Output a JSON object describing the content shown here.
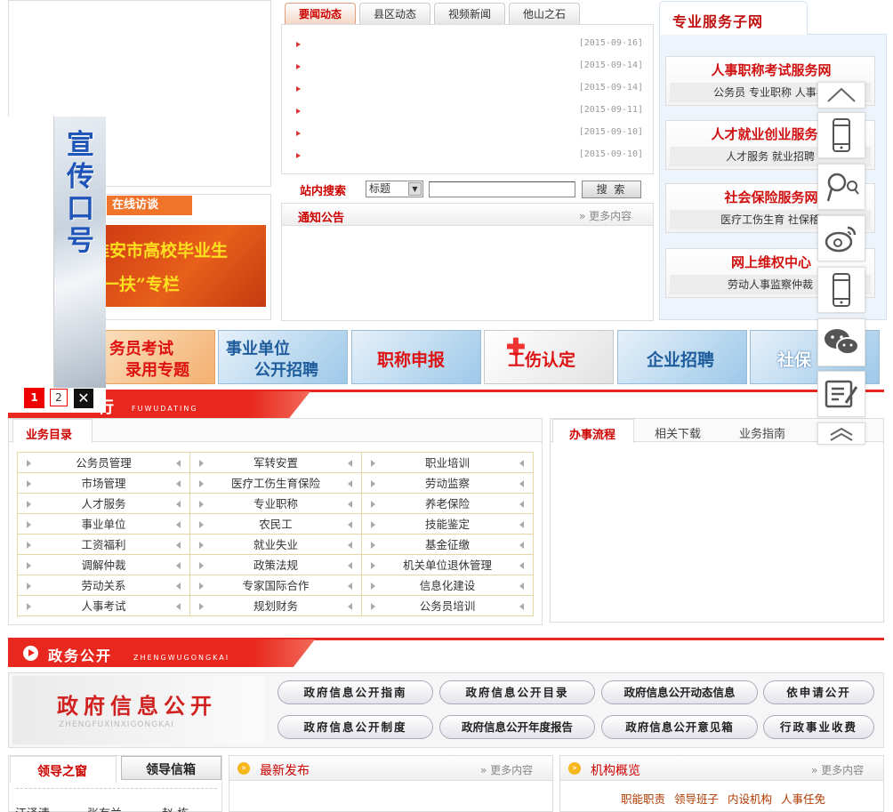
{
  "news": {
    "tabs": [
      "要闻动态",
      "县区动态",
      "视频新闻",
      "他山之石"
    ],
    "dates": [
      "[2015-09-16]",
      "[2015-09-14]",
      "[2015-09-14]",
      "[2015-09-11]",
      "[2015-09-10]",
      "[2015-09-10]"
    ]
  },
  "search": {
    "label": "站内搜索",
    "select_value": "标题",
    "button": "搜 索"
  },
  "notice": {
    "title": "通知公告",
    "more": "更多内容"
  },
  "interview": {
    "label": "在线访谈",
    "banner_line1": "淮安市高校毕业生",
    "banner_line2": "“一扶”专栏"
  },
  "slogan": {
    "text": "宣传口号",
    "pages": [
      "1",
      "2"
    ]
  },
  "services": {
    "header": "专业服务子网",
    "items": [
      {
        "title": "人事职称考试服务网",
        "sub": "公务员 专业职称 人事考"
      },
      {
        "title": "人才就业创业服务网",
        "sub": "人才服务 就业招聘"
      },
      {
        "title": "社会保险服务网",
        "sub": "医疗工伤生育 社保稽"
      },
      {
        "title": "网上维权中心",
        "sub": "劳动人事监察仲裁"
      }
    ]
  },
  "banners": [
    "务员考试",
    "录用专题",
    "事业单位",
    "公开招聘",
    "职称申报",
    "工伤认定",
    "企业招聘",
    "社保"
  ],
  "service_hall": {
    "title": "行",
    "pinyin": "FUWUDATING"
  },
  "business": {
    "tab": "业务目录",
    "rows": [
      [
        "公务员管理",
        "军转安置",
        "职业培训"
      ],
      [
        "市场管理",
        "医疗工伤生育保险",
        "劳动监察"
      ],
      [
        "人才服务",
        "专业职称",
        "养老保险"
      ],
      [
        "事业单位",
        "农民工",
        "技能鉴定"
      ],
      [
        "工资福利",
        "就业失业",
        "基金征缴"
      ],
      [
        "调解仲裁",
        "政策法规",
        "机关单位退休管理"
      ],
      [
        "劳动关系",
        "专家国际合作",
        "信息化建设"
      ],
      [
        "人事考试",
        "规划财务",
        "公务员培训"
      ]
    ]
  },
  "process": {
    "tabs": [
      "办事流程",
      "相关下载",
      "业务指南"
    ]
  },
  "gov": {
    "title": "政务公开",
    "pinyin": "ZHENGWUGONGKAI",
    "banner_title": "政府信息公开",
    "banner_pinyin": "ZHENGFUXINXIGONGKAI",
    "buttons": [
      [
        "政府信息公开指南",
        "政府信息公开目录",
        "政府信息公开动态信息",
        "依申请公开"
      ],
      [
        "政府信息公开制度",
        "政府信息公开年度报告",
        "政府信息公开意见箱",
        "行政事业收费"
      ]
    ]
  },
  "bottom": {
    "leader_tabs": [
      "领导之窗",
      "领导信箱"
    ],
    "leader_names": [
      "江泽清",
      "张有兰",
      "赵 栋"
    ],
    "latest": {
      "title": "最新发布",
      "more": "更多内容"
    },
    "org": {
      "title": "机构概览",
      "more": "更多内容",
      "links": [
        "职能职责",
        "领导班子",
        "内设机构",
        "人事任免"
      ]
    }
  },
  "colors": {
    "red": "#d01010",
    "accent": "#e8281e",
    "banner_blue": "#2a6fb0"
  }
}
